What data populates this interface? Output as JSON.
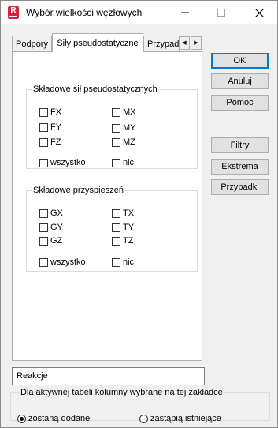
{
  "window": {
    "title": "Wybór wielkości węzłowych",
    "app_icon_letter": "R",
    "accent_color": "#d2233f"
  },
  "tabs": [
    {
      "label": "Podpory",
      "active": false
    },
    {
      "label": "Siły pseudostatyczne",
      "active": true
    },
    {
      "label": "Przypadki",
      "active": false
    }
  ],
  "groups": {
    "forces": {
      "title": "Składowe sił pseudostatycznych",
      "items": [
        {
          "label": "FX",
          "checked": false
        },
        {
          "label": "MX",
          "checked": false
        },
        {
          "label": "FY",
          "checked": false
        },
        {
          "label": "MY",
          "checked": false
        },
        {
          "label": "FZ",
          "checked": false
        },
        {
          "label": "MZ",
          "checked": false
        }
      ],
      "all_label": "wszystko",
      "none_label": "nic"
    },
    "accelerations": {
      "title": "Składowe przyspieszeń",
      "items": [
        {
          "label": "GX",
          "checked": false
        },
        {
          "label": "TX",
          "checked": false
        },
        {
          "label": "GY",
          "checked": false
        },
        {
          "label": "TY",
          "checked": false
        },
        {
          "label": "GZ",
          "checked": false
        },
        {
          "label": "TZ",
          "checked": false
        }
      ],
      "all_label": "wszystko",
      "none_label": "nic"
    }
  },
  "buttons": {
    "ok": "OK",
    "cancel": "Anuluj",
    "help": "Pomoc",
    "filters": "Filtry",
    "extremes": "Ekstrema",
    "cases": "Przypadki"
  },
  "reactions_field": "Reakcje",
  "bottom_group": {
    "title": "Dla aktywnej tabeli kolumny wybrane na tej zakładce",
    "option_add": "zostaną dodane",
    "option_replace": "zastąpią istniejące",
    "selected": "option_add"
  }
}
